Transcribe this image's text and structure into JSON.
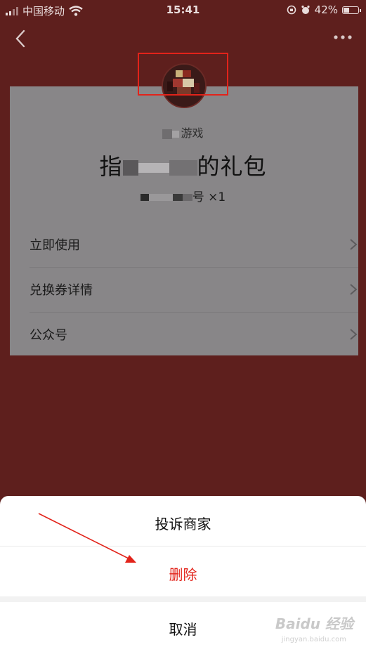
{
  "status_bar": {
    "carrier": "中国移动",
    "time": "15:41",
    "battery": "42%",
    "battery_level": 0.42,
    "icons": [
      "signal-icon",
      "wifi-icon",
      "orientation-lock-icon",
      "alarm-icon",
      "battery-icon"
    ]
  },
  "nav": {
    "back_icon": "chevron-left-icon",
    "more_icon": "more-icon"
  },
  "gift": {
    "merchant": "游戏",
    "title_start": "指",
    "title_end": "的礼包",
    "subtitle_suffix": "号 ×1"
  },
  "menu": {
    "items": [
      {
        "label": "立即使用"
      },
      {
        "label": "兑换券详情"
      },
      {
        "label": "公众号"
      }
    ]
  },
  "action_sheet": {
    "report": "投诉商家",
    "delete": "删除",
    "cancel": "取消"
  },
  "watermark": {
    "brand": "Baidu 经验",
    "url": "jingyan.baidu.com"
  },
  "colors": {
    "overlay_bg": "#5e1f1d",
    "card_bg": "#888688",
    "delete_text": "#e2231a",
    "annotation_red": "#e2231a"
  }
}
